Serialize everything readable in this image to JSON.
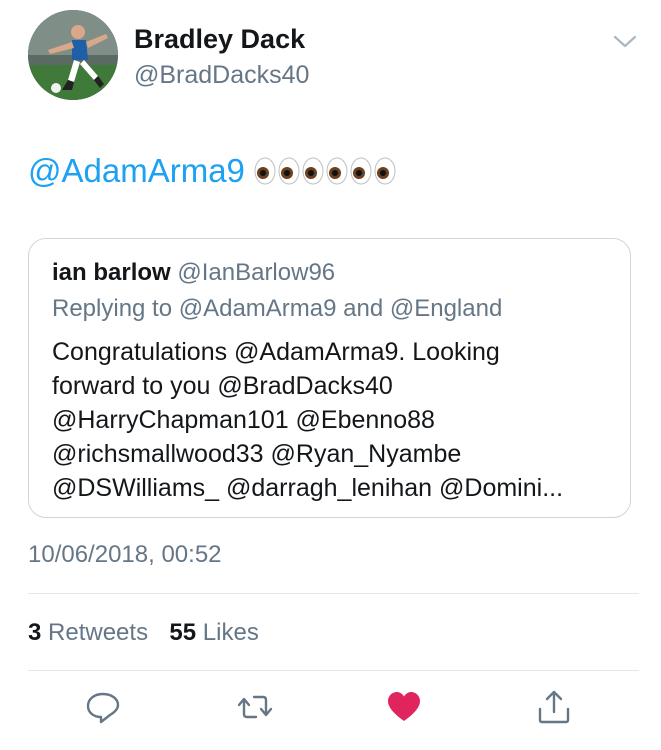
{
  "author": {
    "name": "Bradley Dack",
    "handle": "@BradDacks40",
    "avatar_icon": "footballer-avatar"
  },
  "tweet": {
    "mention": "@AdamArma9",
    "emoji": "eyes-emoji",
    "emoji_count": 6
  },
  "quoted": {
    "name": "ian barlow",
    "handle": "@IanBarlow96",
    "reply_to": "Replying to @AdamArma9 and @England",
    "body": "Congratulations @AdamArma9. Looking\nforward to you @BradDacks40\n@HarryChapman101 @Ebenno88\n@richsmallwood33 @Ryan_Nyambe\n@DSWilliams_ @darragh_lenihan @Domini..."
  },
  "timestamp": "10/06/2018, 00:52",
  "stats": {
    "retweets_count": "3",
    "retweets_label": "Retweets",
    "likes_count": "55",
    "likes_label": "Likes"
  },
  "colors": {
    "mention": "#1da1f2",
    "secondary_text": "#657786",
    "like_active": "#e0245e",
    "icon": "#657786"
  },
  "actions": [
    "reply-icon",
    "retweet-icon",
    "like-icon",
    "share-icon"
  ]
}
